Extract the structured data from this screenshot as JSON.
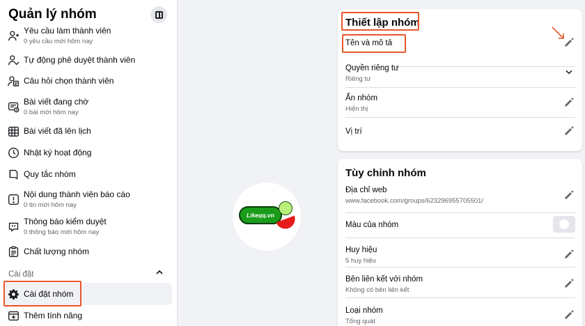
{
  "sidebar": {
    "title": "Quản lý nhóm",
    "items": [
      {
        "label": "Yêu cầu làm thành viên",
        "sub": "0 yêu cầu mới hôm nay",
        "icon": "member-request-icon"
      },
      {
        "label": "Tự động phê duyệt thành viên",
        "sub": "",
        "icon": "auto-approve-icon"
      },
      {
        "label": "Câu hỏi chọn thành viên",
        "sub": "",
        "icon": "member-questions-icon"
      },
      {
        "label": "Bài viết đang chờ",
        "sub": "0 bài mới hôm nay",
        "icon": "pending-posts-icon"
      },
      {
        "label": "Bài viết đã lên lịch",
        "sub": "",
        "icon": "scheduled-posts-icon"
      },
      {
        "label": "Nhật ký hoạt động",
        "sub": "",
        "icon": "activity-log-icon"
      },
      {
        "label": "Quy tắc nhóm",
        "sub": "",
        "icon": "group-rules-icon"
      },
      {
        "label": "Nội dung thành viên báo cáo",
        "sub": "0 tin mới hôm nay",
        "icon": "reported-content-icon"
      },
      {
        "label": "Thông báo kiểm duyệt",
        "sub": "0 thông báo mới hôm nay",
        "icon": "moderation-alerts-icon"
      },
      {
        "label": "Chất lượng nhóm",
        "sub": "",
        "icon": "group-quality-icon"
      }
    ],
    "section_label": "Cài đặt",
    "settings_items": [
      {
        "label": "Cài đặt nhóm",
        "icon": "gear-icon",
        "active": true
      },
      {
        "label": "Thêm tính năng",
        "icon": "add-features-icon",
        "active": false
      }
    ]
  },
  "center_logo": {
    "text": "Likeqq.vn"
  },
  "group_settings": {
    "title": "Thiết lập nhóm",
    "rows": [
      {
        "label": "Tên và mô tả",
        "sub": "",
        "action": "pencil-icon"
      },
      {
        "label": "Quyền riêng tư",
        "sub": "Riêng tư",
        "action": "chevron-down-icon"
      },
      {
        "label": "Ẩn nhóm",
        "sub": "Hiển thị",
        "action": "pencil-icon"
      },
      {
        "label": "Vị trí",
        "sub": "",
        "action": "pencil-icon"
      }
    ]
  },
  "customize": {
    "title": "Tùy chỉnh nhóm",
    "rows": [
      {
        "label": "Địa chỉ web",
        "sub": "www.facebook.com/groups/623296955705501/",
        "action": "pencil-icon"
      },
      {
        "label": "Màu của nhóm",
        "sub": "",
        "action": "color-toggle"
      },
      {
        "label": "Huy hiệu",
        "sub": "5 huy hiệu",
        "action": "pencil-icon"
      },
      {
        "label": "Bên liên kết với nhóm",
        "sub": "Không có bên liên kết",
        "action": "pencil-icon"
      },
      {
        "label": "Loại nhóm",
        "sub": "Tổng quát",
        "action": "pencil-icon"
      }
    ]
  },
  "colors": {
    "highlight": "#e8562a",
    "bg": "#f0f2f5",
    "text_secondary": "#65676b"
  }
}
